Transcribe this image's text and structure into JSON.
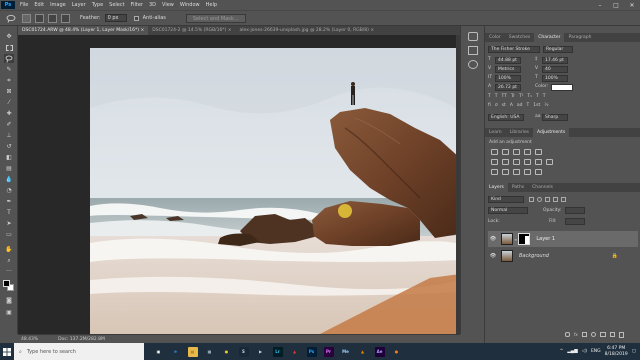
{
  "menubar": {
    "logo": "Ps",
    "items": [
      "File",
      "Edit",
      "Image",
      "Layer",
      "Type",
      "Select",
      "Filter",
      "3D",
      "View",
      "Window",
      "Help"
    ],
    "window_controls": [
      "–",
      "□",
      "✕"
    ]
  },
  "optionsbar": {
    "feather_label": "Feather:",
    "feather_value": "0 px",
    "antialias_label": "Anti-alias",
    "select_mask_label": "Select and Mask..."
  },
  "document_tabs": [
    {
      "label": "DSC01724.ARW @ 48.4% (Layer 1, Layer Mask/16*) ×",
      "active": true
    },
    {
      "label": "DSC01724-2 @ 14.5% (RGB/16*) ×",
      "active": false
    },
    {
      "label": "alex-jones-26639-unsplash.jpg @ 28.2% (Layer 0, RGB/8) ×",
      "active": false
    }
  ],
  "statusbar": {
    "zoom": "48.43%",
    "doc": "Doc: 137.2M/282.8M"
  },
  "character_panel": {
    "tabs": [
      "Color",
      "Swatches",
      "Character",
      "Paragraph"
    ],
    "active_tab": "Character",
    "font_family": "The Fisher Stroke",
    "font_style": "Regular",
    "font_size": "44.88 pt",
    "leading": "17.46 pt",
    "kerning": "Metrics",
    "tracking": "40",
    "vertical_scale": "100%",
    "horizontal_scale": "100%",
    "baseline_shift": "26.72 pt",
    "color_label": "Color:",
    "type_buttons": [
      "T",
      "T",
      "TT",
      "Tr",
      "T¹",
      "T₁",
      "T",
      "T"
    ],
    "opentype_buttons": [
      "fi",
      "σ",
      "st",
      "A",
      "ad",
      "T",
      "1st",
      "½"
    ],
    "language": "English: USA",
    "antialias_icon": "aa",
    "antialias": "Sharp"
  },
  "adjustments_panel": {
    "tabs": [
      "Learn",
      "Libraries",
      "Adjustments"
    ],
    "active_tab": "Adjustments",
    "title": "Add an adjustment"
  },
  "layers_panel": {
    "tabs": [
      "Layers",
      "Paths",
      "Channels"
    ],
    "active_tab": "Layers",
    "filter_kind": "Kind",
    "blend_mode": "Normal",
    "opacity_label": "Opacity:",
    "lock_label": "Lock:",
    "fill_label": "Fill:",
    "layers": [
      {
        "name": "Layer 1",
        "selected": true
      },
      {
        "name": "Background",
        "locked": true
      }
    ],
    "footer_icons": [
      "link-icon",
      "fx-icon",
      "mask-icon",
      "adjustment-icon",
      "folder-icon",
      "new-layer-icon",
      "trash-icon"
    ]
  },
  "taskbar": {
    "search_placeholder": "Type here to search",
    "apps": [
      {
        "name": "task-view",
        "label": "▣",
        "color": "#1f2f3d",
        "fg": "#ffffff"
      },
      {
        "name": "edge",
        "label": "e",
        "color": "#1f2f3d",
        "fg": "#3a8ee6"
      },
      {
        "name": "file-explorer",
        "label": "▤",
        "color": "#e8b84a",
        "fg": "#7a5a10"
      },
      {
        "name": "store",
        "label": "▦",
        "color": "#1f2f3d",
        "fg": "#cfd8e0"
      },
      {
        "name": "chrome",
        "label": "●",
        "color": "#1f2f3d",
        "fg": "#f2c230"
      },
      {
        "name": "steam",
        "label": "S",
        "color": "#1b2838",
        "fg": "#c7d5e0"
      },
      {
        "name": "media",
        "label": "▶",
        "color": "#1f2f3d",
        "fg": "#d0d0d0"
      },
      {
        "name": "lightroom",
        "label": "Lr",
        "color": "#001d26",
        "fg": "#31c5f0"
      },
      {
        "name": "acrobat",
        "label": "▲",
        "color": "#1f2f3d",
        "fg": "#e33b2e"
      },
      {
        "name": "photoshop",
        "label": "Ps",
        "color": "#001e36",
        "fg": "#31a8ff"
      },
      {
        "name": "premiere",
        "label": "Pr",
        "color": "#2a003f",
        "fg": "#e77cff"
      },
      {
        "name": "media-encoder",
        "label": "Me",
        "color": "#1f2f3d",
        "fg": "#9bd2ff"
      },
      {
        "name": "vlc",
        "label": "▲",
        "color": "#1f2f3d",
        "fg": "#f08a00"
      },
      {
        "name": "after-effects",
        "label": "Ae",
        "color": "#1e0038",
        "fg": "#b59bff"
      },
      {
        "name": "firefox",
        "label": "●",
        "color": "#1f2f3d",
        "fg": "#ff7a1a"
      }
    ],
    "tray_language": "ENG",
    "time": "6:47 PM",
    "date": "8/18/2019"
  },
  "colors": {
    "ps_blue": "#31a8ff",
    "panel_bg": "#535353",
    "dark_bg": "#282828",
    "taskbar_bg": "#1f2f3d"
  }
}
